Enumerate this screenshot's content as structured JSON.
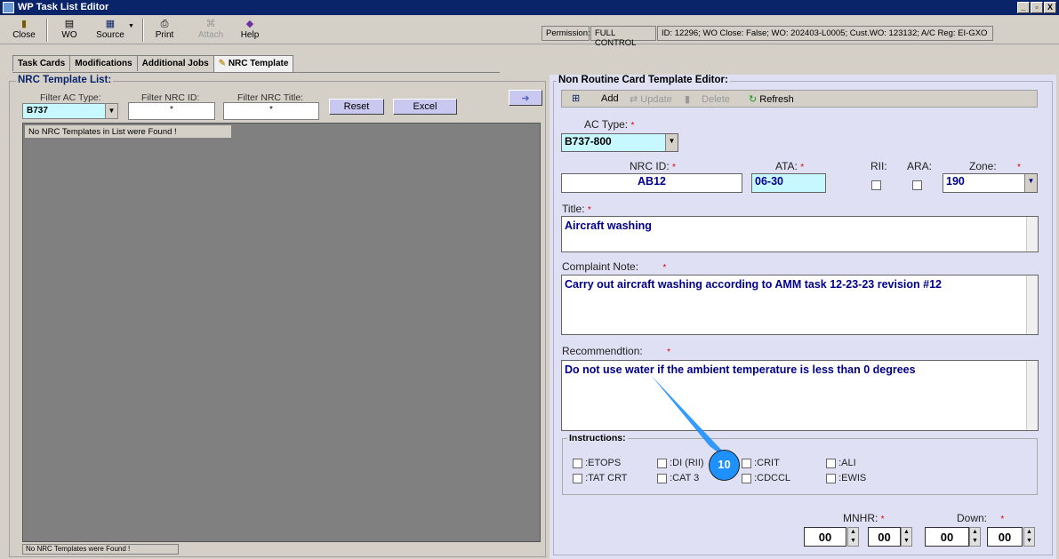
{
  "window": {
    "title": "WP Task List Editor",
    "min": "_",
    "restore": "▫",
    "close": "X"
  },
  "toolbar": {
    "close": "Close",
    "wo": "WO",
    "source": "Source",
    "print": "Print",
    "attach": "Attach",
    "help": "Help"
  },
  "status": {
    "permission_label": "Permission:",
    "permission_value": "FULL CONTROL",
    "info": "ID: 12296; WO Close: False; WO: 202403-L0005; Cust.WO: 123132; A/C Reg: EI-GXO"
  },
  "tabs": [
    "Task Cards",
    "Modifications",
    "Additional Jobs",
    "NRC Template"
  ],
  "list": {
    "title": "NRC Template List:",
    "filter_ac_label": "Filter AC Type:",
    "filter_ac_value": "B737",
    "filter_id_label": "Filter NRC ID:",
    "filter_id_value": "*",
    "filter_title_label": "Filter NRC Title:",
    "filter_title_value": "*",
    "reset": "Reset",
    "excel": "Excel",
    "arrow": "➜",
    "empty_msg": "No NRC Templates in List were Found !",
    "status": "No NRC Templates were Found !"
  },
  "editor": {
    "title": "Non Routine Card Template Editor:",
    "add": "Add",
    "update": "Update",
    "delete": "Delete",
    "refresh": "Refresh",
    "ac_type_label": "AC Type:",
    "ac_type_value": "B737-800",
    "nrc_id_label": "NRC ID:",
    "nrc_id_value": "AB12",
    "ata_label": "ATA:",
    "ata_value": "06-30",
    "rii_label": "RII:",
    "ara_label": "ARA:",
    "zone_label": "Zone:",
    "zone_value": "190",
    "title_label": "Title:",
    "title_value": "Aircraft washing",
    "complaint_label": "Complaint Note:",
    "complaint_value": "Carry out aircraft washing  according to AMM task 12-23-23 revision #12",
    "recommendation_label": "Recommendtion:",
    "recommendation_value": "Do not use water if the ambient temperature is less than 0 degrees",
    "required": "*",
    "instructions_label": "Instructions:",
    "instructions": [
      ":ETOPS",
      ":DI (RII)",
      ":CRIT",
      ":ALI",
      ":TAT CRT",
      ":CAT 3",
      ":CDCCL",
      ":EWIS"
    ],
    "mnhr_label": "MNHR:",
    "down_label": "Down:",
    "mnhr_h": "00",
    "mnhr_m": "00",
    "down_h": "00",
    "down_m": "00"
  },
  "annotation": {
    "marker": "10"
  }
}
